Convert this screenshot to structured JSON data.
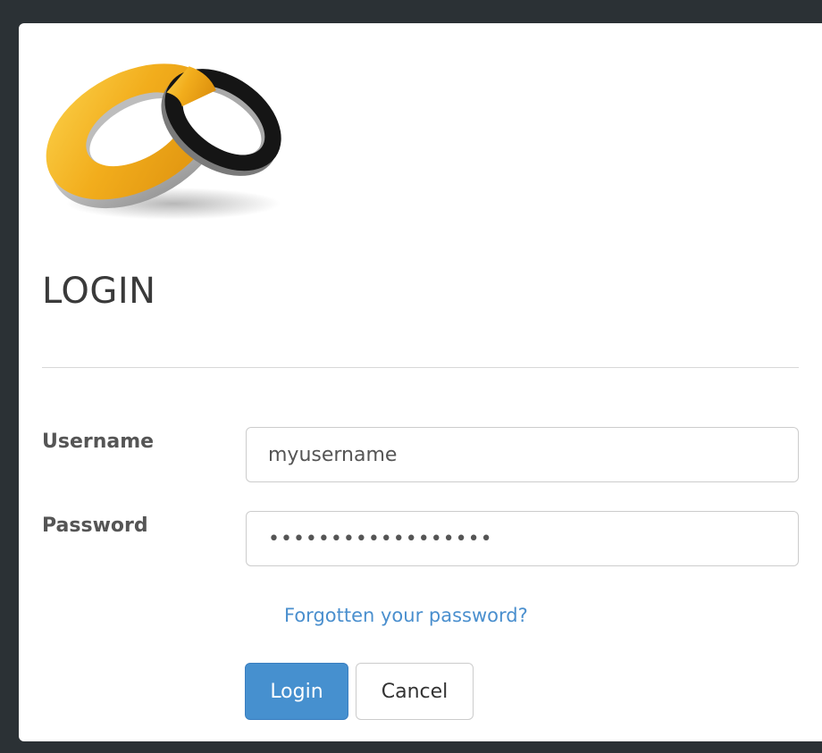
{
  "login": {
    "title": "LOGIN",
    "username_label": "Username",
    "username_value": "myusername",
    "password_label": "Password",
    "password_value": "••••••••••••••••••",
    "forgot_link": "Forgotten your password?",
    "login_button": "Login",
    "cancel_button": "Cancel"
  },
  "colors": {
    "background": "#2b3135",
    "panel": "#ffffff",
    "primary_button": "#4690cf",
    "link": "#4a8fce",
    "logo_gold": "#f0aa1a",
    "logo_black": "#151515"
  },
  "icons": {
    "logo": "interlocking-gold-and-black-rings-logo"
  }
}
